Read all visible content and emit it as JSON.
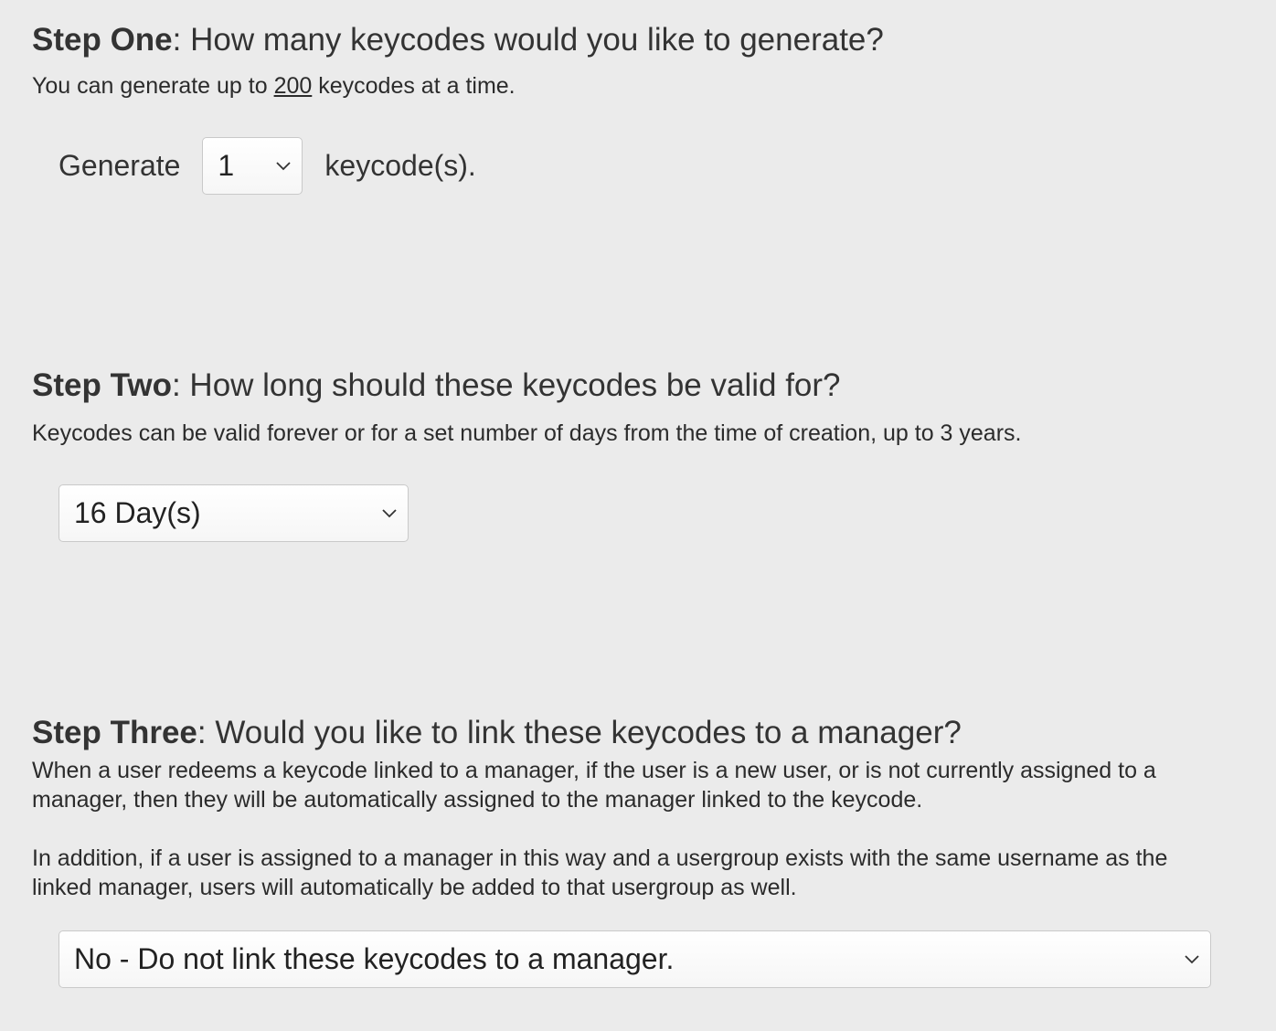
{
  "step_one": {
    "label": "Step One",
    "question": ": How many keycodes would you like to generate?",
    "desc_before": "You can generate up to ",
    "desc_max": "200",
    "desc_after": " keycodes at a time.",
    "generate_prefix": "Generate",
    "generate_value": "1",
    "generate_suffix": "keycode(s)."
  },
  "step_two": {
    "label": "Step Two",
    "question": ": How long should these keycodes be valid for?",
    "desc": "Keycodes can be valid forever or for a set number of days from the time of creation, up to 3 years.",
    "validity_value": "16 Day(s)"
  },
  "step_three": {
    "label": "Step Three",
    "question": ": Would you like to link these keycodes to a manager?",
    "desc_1": "When a user redeems a keycode linked to a manager, if the user is a new user, or is not currently assigned to a manager, then they will be automatically assigned to the manager linked to the keycode.",
    "desc_2": "In addition, if a user is assigned to a manager in this way and a usergroup exists with the same username as the linked manager, users will automatically be added to that usergroup as well.",
    "manager_value": "No - Do not link these keycodes to a manager."
  },
  "icons": {
    "dropdown": "chevron-down-icon"
  }
}
